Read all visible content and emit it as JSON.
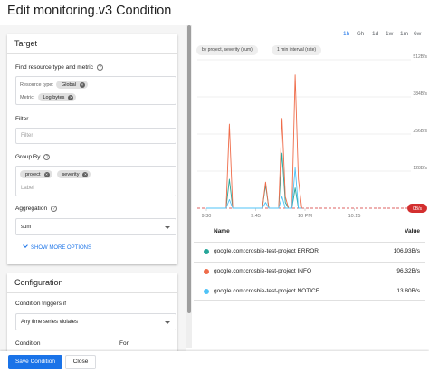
{
  "title": "Edit monitoring.v3 Condition",
  "target": {
    "header": "Target",
    "resource_label": "Find resource type and metric",
    "resource_type_prefix": "Resource type:",
    "resource_type_value": "Global",
    "metric_prefix": "Metric:",
    "metric_value": "Log bytes",
    "filter_label": "Filter",
    "filter_placeholder": "Filter",
    "group_by_label": "Group By",
    "group_by_chips": [
      "project",
      "severity"
    ],
    "group_by_placeholder": "Label",
    "aggregation_label": "Aggregation",
    "aggregation_value": "sum",
    "show_more": "SHOW MORE OPTIONS",
    "help_glyph": "?"
  },
  "configuration": {
    "header": "Configuration",
    "triggers_label": "Condition triggers if",
    "triggers_value": "Any time series violates",
    "condition_label": "Condition",
    "for_label": "For"
  },
  "buttons": {
    "save": "Save Condition",
    "close": "Close"
  },
  "time_range": {
    "options": [
      "1h",
      "6h",
      "1d",
      "1w",
      "1m",
      "6w"
    ],
    "selected": "1h"
  },
  "chart_tags": [
    "by project, severity (sum)",
    "1 min interval (rate)"
  ],
  "colors": {
    "accent": "#1a73e8",
    "error_series": "#26a69a",
    "info_series": "#ef6c4a",
    "notice_series": "#4fc3f7",
    "threshold": "#d32f2f"
  },
  "chart_data": {
    "type": "line",
    "x_ticks": [
      "9:30",
      "9:45",
      "10 PM",
      "10:15"
    ],
    "y_ticks": [
      "512B/s",
      "384B/s",
      "256B/s",
      "128B/s"
    ],
    "threshold_label": "0B/s",
    "ylim": [
      0,
      512
    ],
    "x_minutes": [
      0,
      4,
      6,
      7,
      8,
      9,
      10,
      11,
      12,
      13,
      14,
      15,
      16,
      17,
      18,
      19,
      20,
      21,
      22,
      23,
      24,
      25,
      26,
      27,
      28,
      29
    ],
    "series": [
      {
        "name": "google.com:crosbie-test-project ERROR",
        "values": [
          0,
          0,
          0,
          100,
          0,
          0,
          0,
          0,
          0,
          0,
          0,
          0,
          0,
          0,
          80,
          0,
          0,
          0,
          0,
          190,
          20,
          0,
          0,
          70,
          0,
          0
        ]
      },
      {
        "name": "google.com:crosbie-test-project INFO",
        "values": [
          0,
          0,
          0,
          290,
          0,
          0,
          0,
          0,
          0,
          0,
          0,
          0,
          0,
          0,
          90,
          0,
          0,
          0,
          0,
          310,
          40,
          0,
          0,
          460,
          100,
          0
        ]
      },
      {
        "name": "google.com:crosbie-test-project NOTICE",
        "values": [
          0,
          0,
          0,
          30,
          0,
          0,
          0,
          0,
          0,
          0,
          0,
          0,
          0,
          0,
          20,
          0,
          0,
          0,
          0,
          40,
          0,
          0,
          0,
          140,
          0,
          0
        ]
      }
    ]
  },
  "legend": {
    "name_header": "Name",
    "value_header": "Value",
    "rows": [
      {
        "name": "google.com:crosbie-test-project ERROR",
        "value": "106.93B/s",
        "color": "#26a69a"
      },
      {
        "name": "google.com:crosbie-test-project INFO",
        "value": "96.32B/s",
        "color": "#ef6c4a"
      },
      {
        "name": "google.com:crosbie-test-project NOTICE",
        "value": "13.80B/s",
        "color": "#4fc3f7"
      }
    ]
  }
}
